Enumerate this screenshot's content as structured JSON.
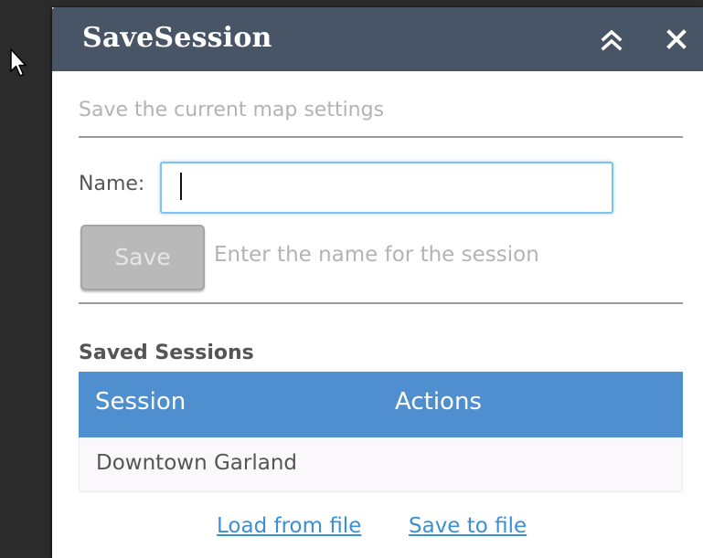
{
  "widget": {
    "title": "SaveSession",
    "subtitle": "Save the current map settings",
    "collapse_icon": "double-chevron-up-icon",
    "close_icon": "close-icon"
  },
  "form": {
    "name_label": "Name:",
    "name_value": "",
    "save_label": "Save",
    "save_enabled": false,
    "hint": "Enter the name for the session"
  },
  "sessions": {
    "title": "Saved Sessions",
    "columns": [
      "Session",
      "Actions"
    ],
    "rows": [
      {
        "session": "Downtown Garland",
        "actions": ""
      }
    ]
  },
  "footer": {
    "load_label": "Load from file",
    "save_label": "Save to file"
  },
  "colors": {
    "header_bg": "#485566",
    "table_header_bg": "#4f8fcf",
    "link": "#3a8fd6",
    "input_focus": "#7fc2f2"
  }
}
